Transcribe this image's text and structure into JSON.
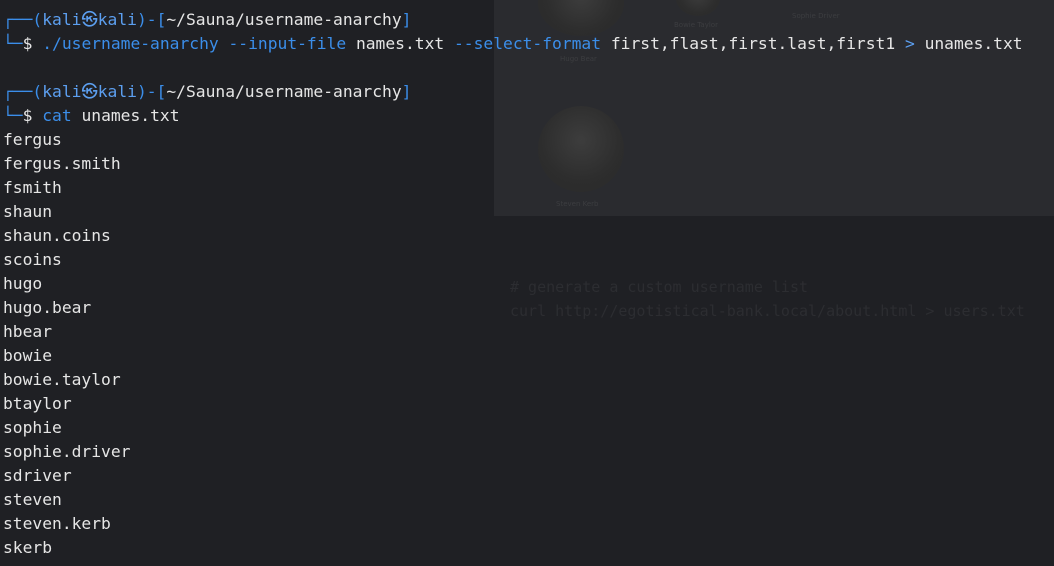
{
  "colors": {
    "background": "#1f2024",
    "frame": "#3b8eea",
    "text": "#e6e6e6"
  },
  "prompt": {
    "open": "┌──(",
    "user": "kali",
    "skull_icon": "㉿",
    "host": "kali",
    "close": ")-[",
    "path": "~/Sauna/username-anarchy",
    "path_end": "]",
    "corner": "└─",
    "symbol": "$"
  },
  "commands": [
    {
      "exec": "./username-anarchy",
      "parts": [
        {
          "type": "flag",
          "text": "--input-file"
        },
        {
          "type": "arg",
          "text": "names.txt"
        },
        {
          "type": "flag",
          "text": "--select-format"
        },
        {
          "type": "arg",
          "text": "first,flast,first.last,first1"
        },
        {
          "type": "redir",
          "text": ">"
        },
        {
          "type": "arg",
          "text": "unames.txt"
        }
      ]
    },
    {
      "exec": "cat",
      "parts": [
        {
          "type": "arg",
          "text": "unames.txt"
        }
      ]
    }
  ],
  "output": [
    "fergus",
    "fergus.smith",
    "fsmith",
    "shaun",
    "shaun.coins",
    "scoins",
    "hugo",
    "hugo.bear",
    "hbear",
    "bowie",
    "bowie.taylor",
    "btaylor",
    "sophie",
    "sophie.driver",
    "sdriver",
    "steven",
    "steven.kerb",
    "skerb"
  ],
  "background_overlay": {
    "captions": [
      "Bowie Taylor",
      "Sophie Driver",
      "Hugo Bear",
      "Steven Kerb"
    ],
    "ghost_lines": [
      "# generate a custom username list",
      "curl http://egotistical-bank.local/about.html > users.txt"
    ]
  }
}
